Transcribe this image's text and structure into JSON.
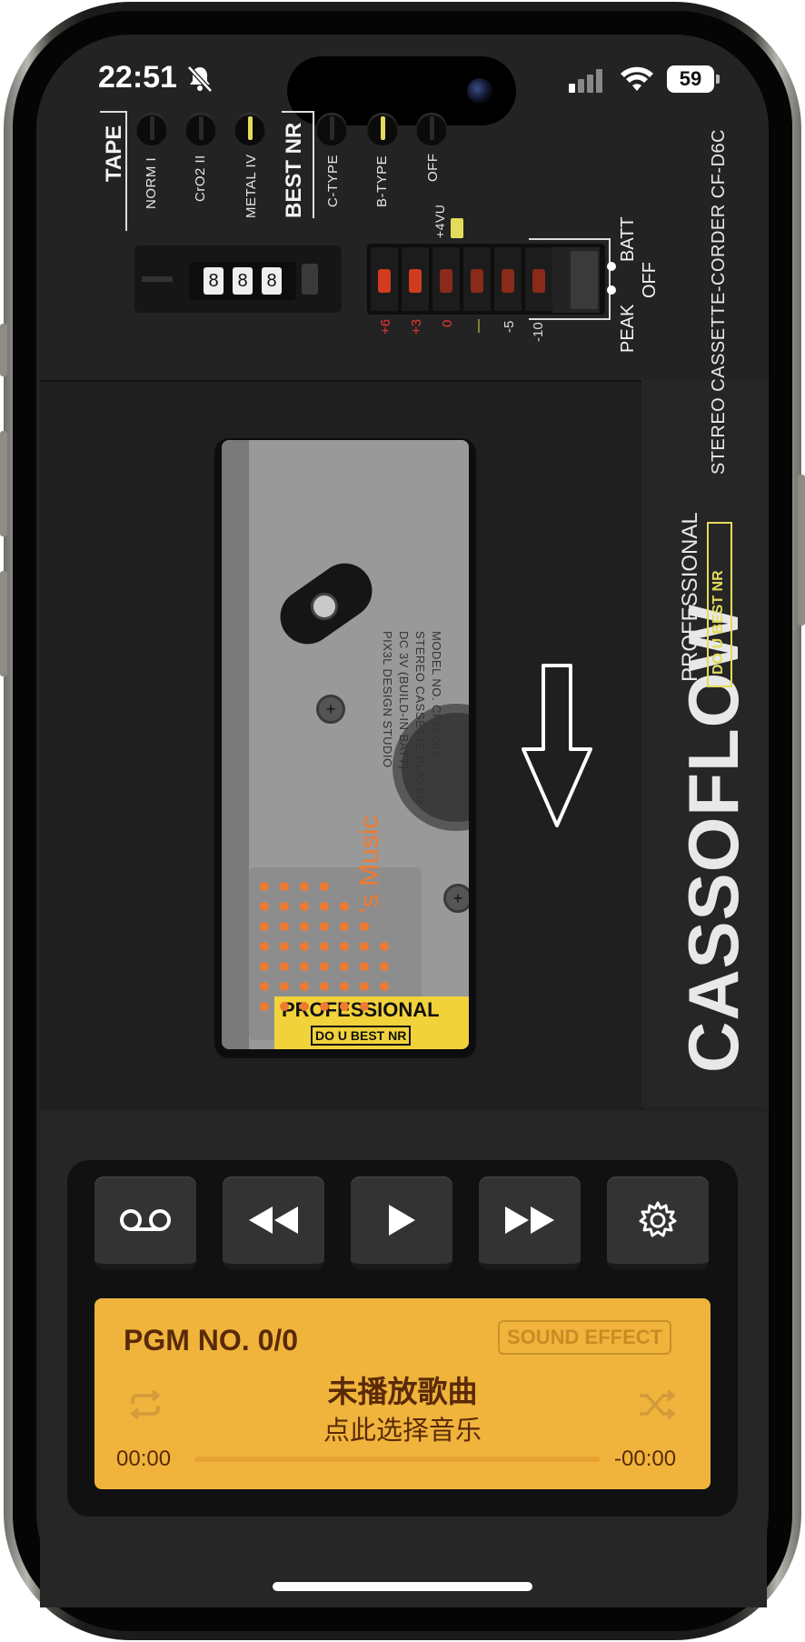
{
  "status_bar": {
    "time": "22:51",
    "battery": "59"
  },
  "deck": {
    "tape_label": "TAPE",
    "tape_options": [
      "NORM I",
      "CrO2 II",
      "METAL IV"
    ],
    "nr_label": "BEST NR",
    "nr_options": [
      "C-TYPE",
      "B-TYPE",
      "OFF"
    ],
    "counter_digits": [
      "8",
      "8",
      "8"
    ],
    "vu_label": "+4VU",
    "meter_scale": [
      "+6",
      "+3",
      "0",
      "—",
      "-5",
      "-10"
    ],
    "switch_labels": {
      "batt": "BATT",
      "peak": "PEAK",
      "off": "OFF"
    },
    "model_text": "STEREO CASSETTE-CORDER CF-D6C",
    "brand": "CASSOFLOW",
    "professional": "PROFESSIONAL",
    "badge": "DO U BEST NR"
  },
  "cassette": {
    "info_lines": [
      "MODEL NO. CFM-001",
      "STEREO CASSETTE PLAYER",
      "DC 3V (BUILD-IN BATT)",
      "PIX3L DESIGN STUDIO"
    ],
    "music_text": "'s Music",
    "badge_top": "PROFESSIONAL",
    "badge_bottom": "DO U BEST NR"
  },
  "transport": {
    "buttons": [
      "voicemail-icon",
      "rewind-icon",
      "play-icon",
      "fast-forward-icon",
      "gear-icon"
    ]
  },
  "display": {
    "program": "PGM NO. 0/0",
    "sound_effect": "SOUND EFFECT",
    "title": "未播放歌曲",
    "subtitle": "点此选择音乐",
    "elapsed": "00:00",
    "remaining": "-00:00",
    "progress": 0
  },
  "colors": {
    "lcd": "#f0b43c",
    "accent_led": "#d13c20",
    "knob_on": "#e3dc5a"
  }
}
